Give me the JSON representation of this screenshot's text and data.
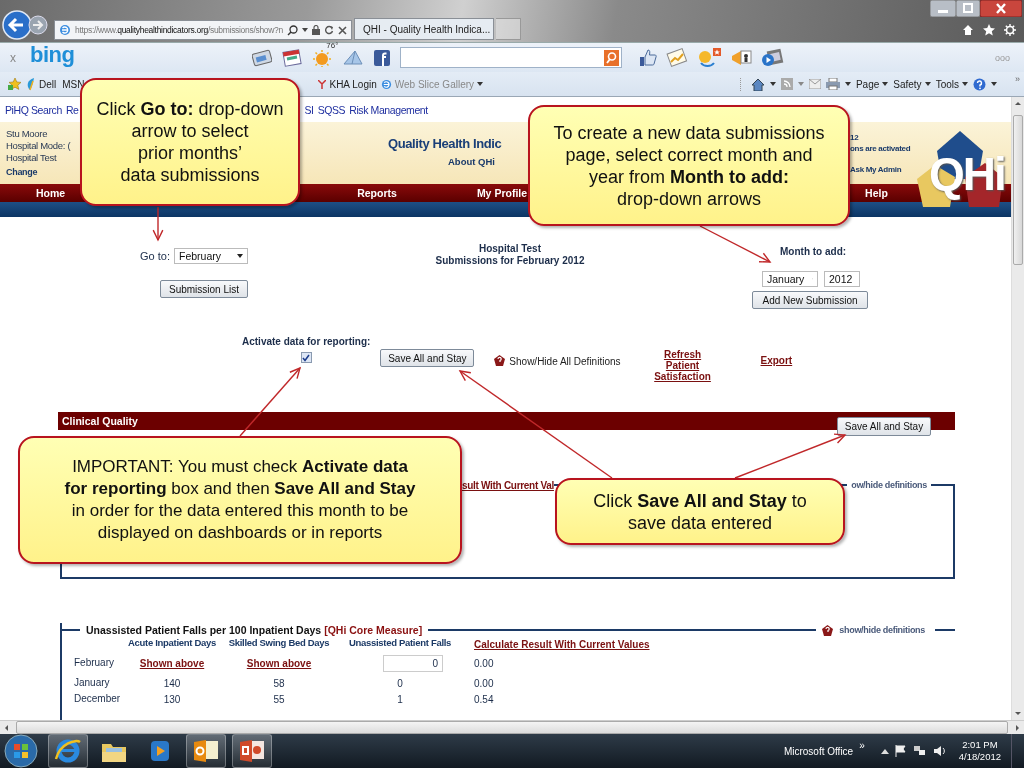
{
  "browser": {
    "address_prefix": "https://www.",
    "address_domain": "qualityhealthindicators.org",
    "address_path": "/submissions/show?n",
    "tab_title": "QHI - Quality Health Indica..."
  },
  "bing_toolbar": {
    "close": "x",
    "logo": "bing",
    "temperature": "76°",
    "overflow": "ooo"
  },
  "favorites_bar": {
    "items": [
      "Dell",
      "MSN",
      "KHA Login",
      "Web Slice Gallery"
    ],
    "commands": [
      "Page",
      "Safety",
      "Tools"
    ],
    "overflow": "»"
  },
  "links": [
    "PiHQ Search",
    "Re",
    "SI",
    "SQSS",
    "Risk Management"
  ],
  "header": {
    "user": "Stu Moore",
    "mode": "Hospital Mode: (",
    "hospital": "Hospital Test",
    "change": "Change",
    "title": "Quality Health Indic",
    "about": "About QHi",
    "notice_1": "12",
    "notice_2": "ons are activated",
    "ask_admin": "Ask My Admin",
    "logo": "QHi"
  },
  "nav": [
    "Home",
    "Reports",
    "My Profile",
    "Help"
  ],
  "go_to": {
    "label": "Go to:",
    "value": "February",
    "button": "Submission List"
  },
  "heading": {
    "hospital": "Hospital Test",
    "submissions": "Submissions for February 2012"
  },
  "month_to_add": {
    "label": "Month to add:",
    "month": "January",
    "year": "2012",
    "button": "Add New Submission"
  },
  "activate": {
    "label": "Activate data for reporting:",
    "checked": true
  },
  "actions": {
    "save": "Save All and Stay",
    "definitions": "Show/Hide All Definitions",
    "refresh": "Refresh Patient Satisfaction",
    "export": "Export"
  },
  "section": {
    "title": "Clinical Quality",
    "save": "Save All and Stay"
  },
  "measure_1": {
    "link": "sult With Current Val",
    "definitions": "ow/hide definitions"
  },
  "measure_2": {
    "title": "Unassisted Patient Falls per 100 Inpatient Days",
    "tag": "[QHi Core Measure]",
    "definitions": "show/hide definitions",
    "columns": [
      "Acute Inpatient Days",
      "Skilled Swing Bed Days",
      "Unassisted Patient Falls",
      "Calculate Result With Current Values"
    ],
    "rows": [
      {
        "month": "February",
        "kind": "current",
        "cells": [
          "Shown above",
          "Shown above",
          "0",
          "0.00"
        ]
      },
      {
        "month": "January",
        "kind": "history",
        "cells": [
          "140",
          "58",
          "0",
          "0.00"
        ]
      },
      {
        "month": "December",
        "kind": "history",
        "cells": [
          "130",
          "55",
          "1",
          "0.54"
        ]
      }
    ]
  },
  "callouts": [
    {
      "lines": [
        "Click **Go to:** drop-down",
        "arrow to select",
        "prior months’",
        "data submissions"
      ]
    },
    {
      "lines": [
        "To create a new data submissions",
        "page, select correct month and",
        "year from **Month to add:**",
        "drop-down arrows"
      ]
    },
    {
      "lines": [
        "IMPORTANT: You must check **Activate data**",
        "**for reporting** box and then **Save All and Stay**",
        "in order for the data entered this month to be",
        "displayed on dashboards or in reports"
      ]
    },
    {
      "lines": [
        "Click **Save All and Stay** to",
        "save data entered"
      ]
    }
  ],
  "taskbar": {
    "notification": "Microsoft Office",
    "expand": "»",
    "time": "2:01 PM",
    "date": "4/18/2012"
  }
}
